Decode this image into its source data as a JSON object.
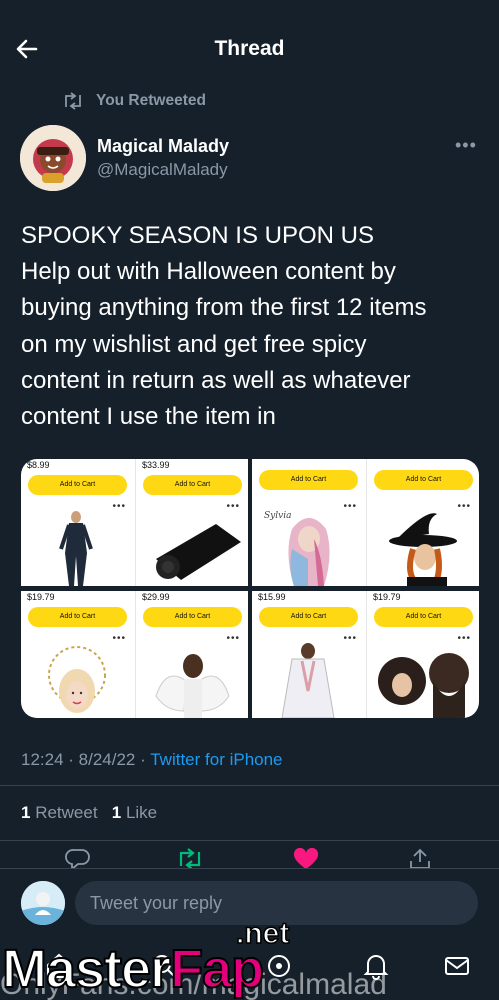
{
  "header": {
    "title": "Thread",
    "back_icon": "arrow-left-icon"
  },
  "retweet_context": {
    "label": "You Retweeted",
    "icon": "retweet-icon"
  },
  "tweet": {
    "author_name": "Magical Malady",
    "author_handle": "@MagicalMalady",
    "text_lines": [
      "SPOOKY SEASON IS UPON US",
      "Help out with Halloween content by",
      "buying anything from the first 12 items",
      "on my wishlist and get free spicy",
      "content in return as well as whatever",
      "content I use the item in"
    ],
    "time": "12:24",
    "date": "8/24/22",
    "separator": "·",
    "source": "Twitter for iPhone",
    "retweet_count": "1",
    "retweet_label": "Retweet",
    "like_count": "1",
    "like_label": "Like"
  },
  "media": {
    "panels": [
      {
        "cells": [
          {
            "price": "$8.99",
            "button": "Add to Cart",
            "more": "•••"
          },
          {
            "price": "$33.99",
            "button": "Add to Cart",
            "more": "•••"
          }
        ]
      },
      {
        "cells": [
          {
            "price": "",
            "button": "Add to Cart",
            "more": "•••",
            "caption": "Sylvia"
          },
          {
            "price": "",
            "button": "Add to Cart",
            "more": "•••"
          }
        ]
      },
      {
        "cells": [
          {
            "price": "$19.79",
            "button": "Add to Cart",
            "more": "•••"
          },
          {
            "price": "$29.99",
            "button": "Add to Cart",
            "more": "•••"
          }
        ]
      },
      {
        "cells": [
          {
            "price": "$15.99",
            "button": "Add to Cart",
            "more": "•••"
          },
          {
            "price": "$19.79",
            "button": "Add to Cart",
            "more": "•••"
          }
        ]
      }
    ]
  },
  "reply": {
    "placeholder": "Tweet your reply"
  },
  "watermark": {
    "brand_white": "Master",
    "brand_pink": "Fap",
    "brand_suffix": ".net",
    "url": "OnlyFans.com/magicalmalad"
  },
  "colors": {
    "background": "#15202b",
    "accent": "#1d9bf0",
    "muted": "#8b98a5",
    "like": "#f91880",
    "retweet": "#00ba7c",
    "cart_button": "#ffd814"
  }
}
